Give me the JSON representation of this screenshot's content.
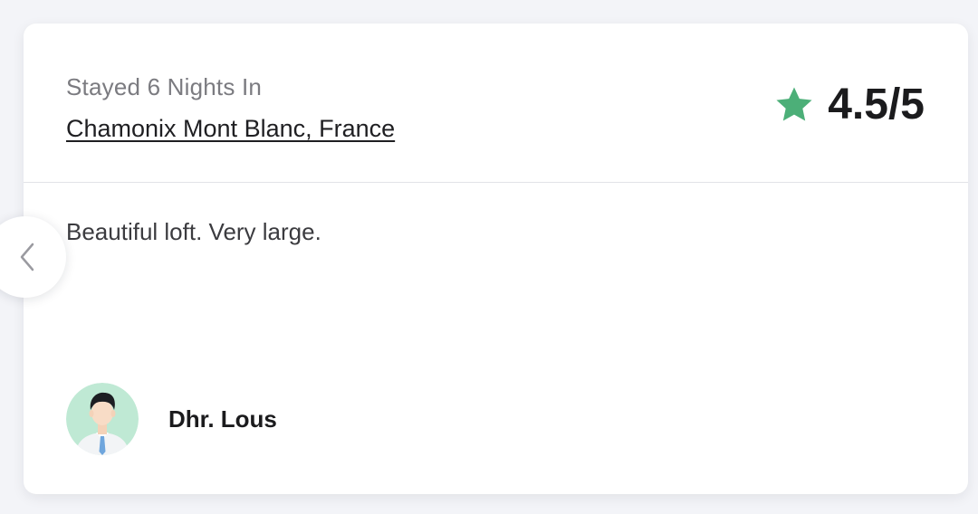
{
  "review": {
    "stay_label": "Stayed 6 Nights In",
    "location": "Chamonix Mont Blanc, France",
    "rating_text": "4.5/5",
    "rating_value": 4.5,
    "rating_max": 5,
    "text": "Beautiful loft. Very large.",
    "author_name": "Dhr. Lous"
  },
  "icons": {
    "rating": "star-icon",
    "previous": "chevron-left-icon",
    "author": "avatar"
  },
  "colors": {
    "star": "#4caf78",
    "avatar_bg": "#bfe9d4",
    "page_bg": "#f3f4f8"
  }
}
